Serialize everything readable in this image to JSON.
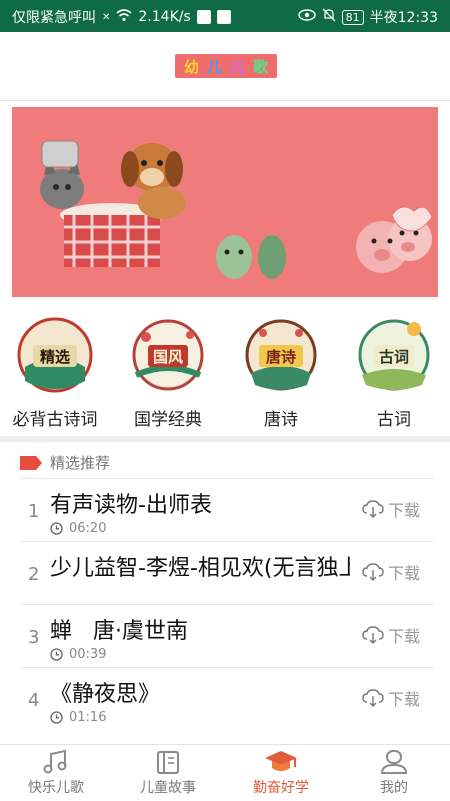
{
  "status_bar": {
    "carrier": "仅限紧急呼叫",
    "net_speed": "2.14K/s",
    "battery": "81",
    "time": "半夜12:33"
  },
  "header": {
    "logo_chars": [
      "幼",
      "儿",
      "儿",
      "歌"
    ]
  },
  "categories": [
    {
      "badge": "精选",
      "label": "必背古诗词"
    },
    {
      "badge": "国风",
      "label": "国学经典"
    },
    {
      "badge": "唐诗",
      "label": "唐诗"
    },
    {
      "badge": "古词",
      "label": "古词"
    }
  ],
  "section": {
    "title": "精选推荐"
  },
  "tracks": [
    {
      "num": "1",
      "title": "有声读物-出师表",
      "duration": "06:20",
      "download": "下载"
    },
    {
      "num": "2",
      "title": "少儿益智-李煜-相见欢(无言独上西楼)",
      "duration": "",
      "download": "下载"
    },
    {
      "num": "3",
      "title": "蝉   唐·虞世南",
      "duration": "00:39",
      "download": "下载"
    },
    {
      "num": "4",
      "title": "《静夜思》",
      "duration": "01:16",
      "download": "下载"
    }
  ],
  "tabs": [
    {
      "label": "快乐儿歌",
      "icon": "music-note-icon"
    },
    {
      "label": "儿童故事",
      "icon": "book-icon"
    },
    {
      "label": "勤奋好学",
      "icon": "graduation-cap-icon"
    },
    {
      "label": "我的",
      "icon": "profile-icon"
    }
  ],
  "colors": {
    "status_bar": "#0f6b45",
    "banner_bg": "#f07b7b",
    "active_tab": "#e25b3b",
    "section_tag": "#e74c3c"
  }
}
